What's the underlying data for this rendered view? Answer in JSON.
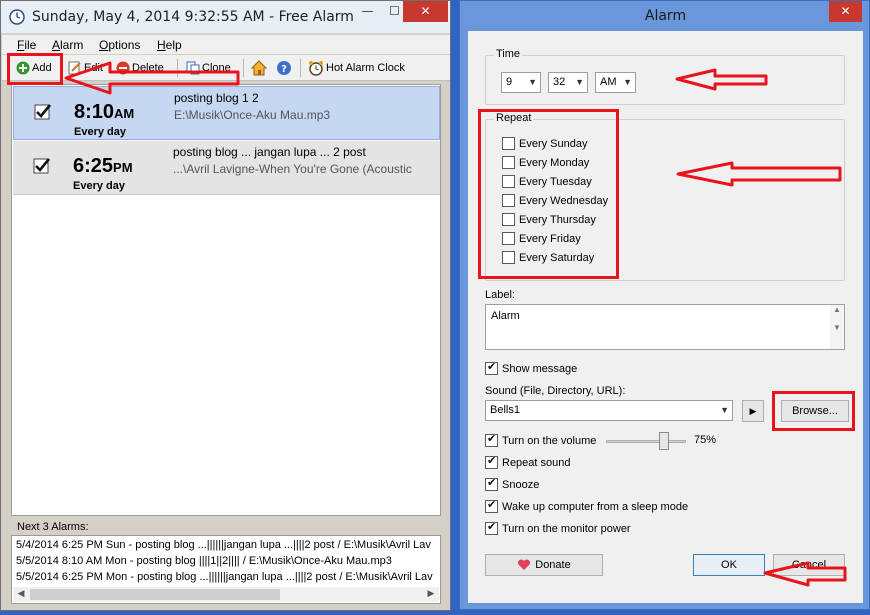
{
  "main_window": {
    "title": "Sunday, May 4, 2014 9:32:55 AM - Free Alarm ...",
    "caption_min": "—",
    "caption_max": "☐",
    "caption_close": "✕",
    "menu": [
      "File",
      "Alarm",
      "Options",
      "Help"
    ],
    "toolbar": {
      "add": "Add",
      "edit": "Edit",
      "delete": "Delete",
      "clone": "Clone",
      "hot_alarm_clock": "Hot Alarm Clock"
    },
    "alarms": [
      {
        "time": "8:10",
        "ampm": "AM",
        "days": "Every day",
        "label": "posting blog   1 2",
        "path": "E:\\Musik\\Once-Aku Mau.mp3",
        "enabled": true,
        "selected": true
      },
      {
        "time": "6:25",
        "ampm": "PM",
        "days": "Every day",
        "label": "posting blog ...   jangan lupa ...   2 post",
        "path": "...\\Avril Lavigne-When You're Gone (Acoustic",
        "enabled": true,
        "selected": false
      }
    ],
    "next_alarms_label": "Next 3 Alarms:",
    "next_alarms": [
      "5/4/2014 6:25 PM Sun - posting blog ...||||||jangan lupa ...||||2 post / E:\\Musik\\Avril Lav",
      "5/5/2014 8:10 AM Mon - posting blog ||||1||2|||| / E:\\Musik\\Once-Aku Mau.mp3",
      "5/5/2014 6:25 PM Mon - posting blog ...||||||jangan lupa ...||||2 post / E:\\Musik\\Avril Lav"
    ]
  },
  "dialog": {
    "title": "Alarm",
    "close": "✕",
    "time_group": "Time",
    "hour": "9",
    "minute": "32",
    "ampm": "AM",
    "repeat_group": "Repeat",
    "repeat_days": [
      {
        "label": "Every Sunday",
        "checked": false
      },
      {
        "label": "Every Monday",
        "checked": false
      },
      {
        "label": "Every Tuesday",
        "checked": false
      },
      {
        "label": "Every Wednesday",
        "checked": false
      },
      {
        "label": "Every Thursday",
        "checked": false
      },
      {
        "label": "Every Friday",
        "checked": false
      },
      {
        "label": "Every Saturday",
        "checked": false
      }
    ],
    "label_caption": "Label:",
    "label_value": "Alarm",
    "show_message": "Show message",
    "sound_caption": "Sound (File, Directory, URL):",
    "sound_value": "Bells1",
    "browse": "Browse...",
    "volume_label": "Turn on the volume",
    "volume_percent": "75%",
    "volume_level": 0.75,
    "options": [
      "Repeat sound",
      "Snooze",
      "Wake up computer from a sleep mode",
      "Turn on the monitor power"
    ],
    "donate": "Donate",
    "ok": "OK",
    "cancel": "Cancel"
  },
  "colors": {
    "annotation_red": "#e8141c",
    "selection_blue": "#c5d7f1",
    "dialog_frame": "#6a97dc"
  }
}
